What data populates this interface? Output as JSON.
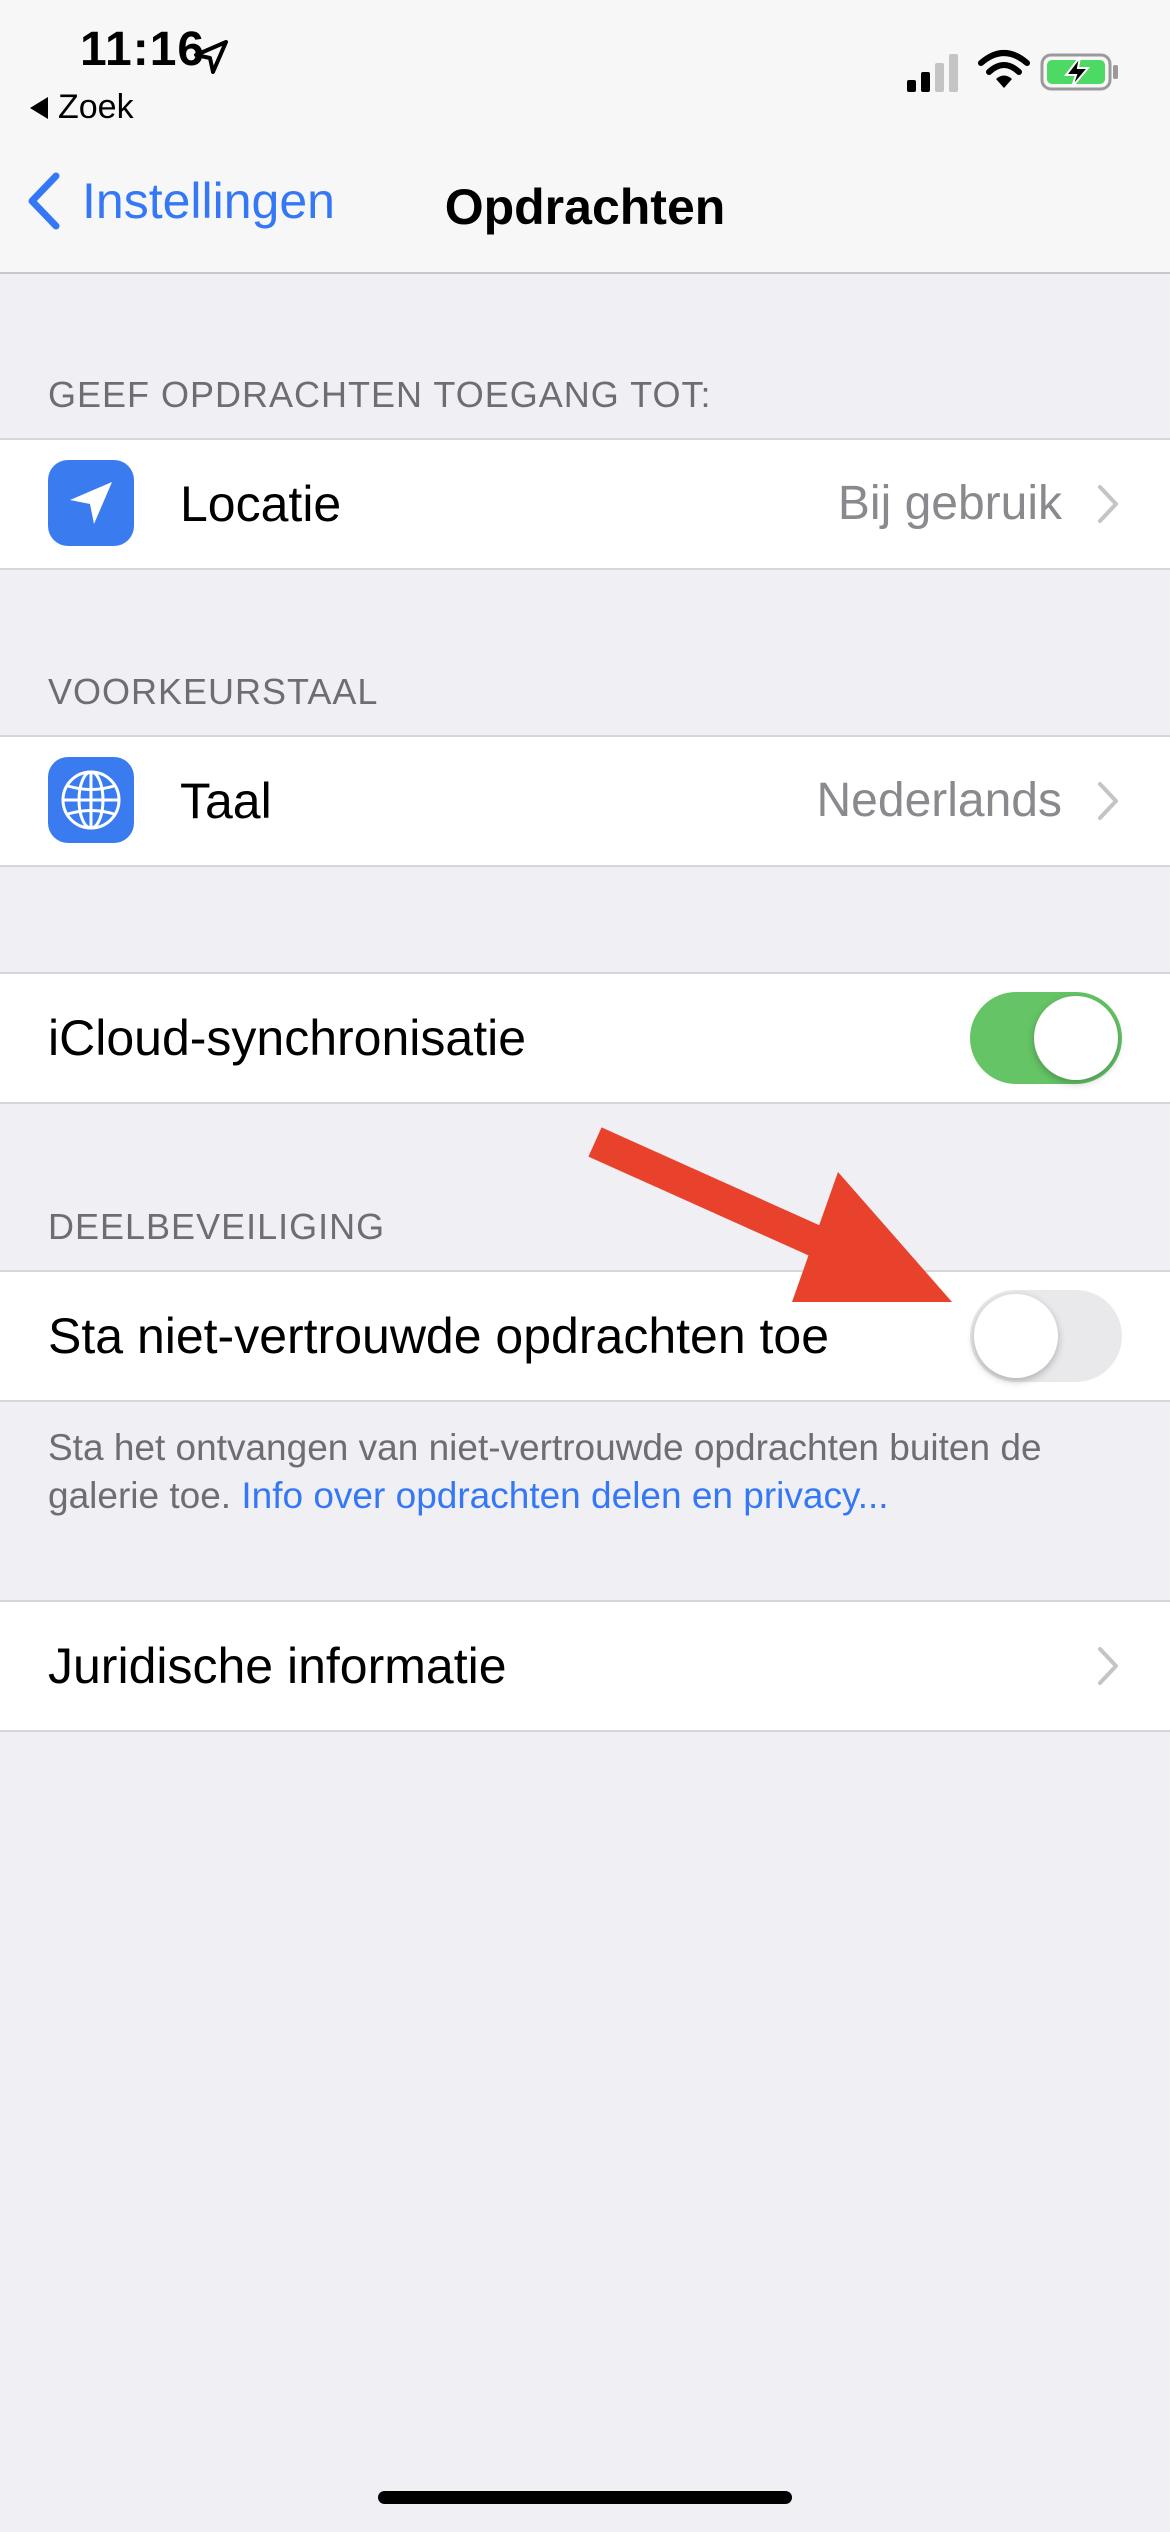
{
  "status_bar": {
    "time": "11:16",
    "back_app": "Zoek",
    "icons": [
      "location-arrow-icon",
      "signal-icon",
      "wifi-icon",
      "battery-charging-icon"
    ]
  },
  "nav": {
    "back_label": "Instellingen",
    "title": "Opdrachten"
  },
  "sections": {
    "access": {
      "header": "GEEF OPDRACHTEN TOEGANG TOT:",
      "location": {
        "label": "Locatie",
        "value": "Bij gebruik",
        "icon": "location-arrow-icon"
      }
    },
    "language": {
      "header": "VOORKEURSTAAL",
      "taal": {
        "label": "Taal",
        "value": "Nederlands",
        "icon": "globe-icon"
      }
    },
    "icloud": {
      "label": "iCloud-synchronisatie",
      "enabled": true
    },
    "sharing": {
      "header": "DEELBEVEILIGING",
      "untrusted": {
        "label": "Sta niet-vertrouwde opdrachten toe",
        "enabled": false
      },
      "footer_text": "Sta het ontvangen van niet-vertrouwde opdrachten buiten de galerie toe.",
      "footer_link": "Info over opdrachten delen en privacy..."
    },
    "legal": {
      "label": "Juridische informatie"
    }
  },
  "colors": {
    "accent": "#3478f6",
    "toggle_on": "#65c466",
    "toggle_off": "#e9e9eb",
    "annotation_arrow": "#e8412c",
    "background": "#efeff4"
  }
}
